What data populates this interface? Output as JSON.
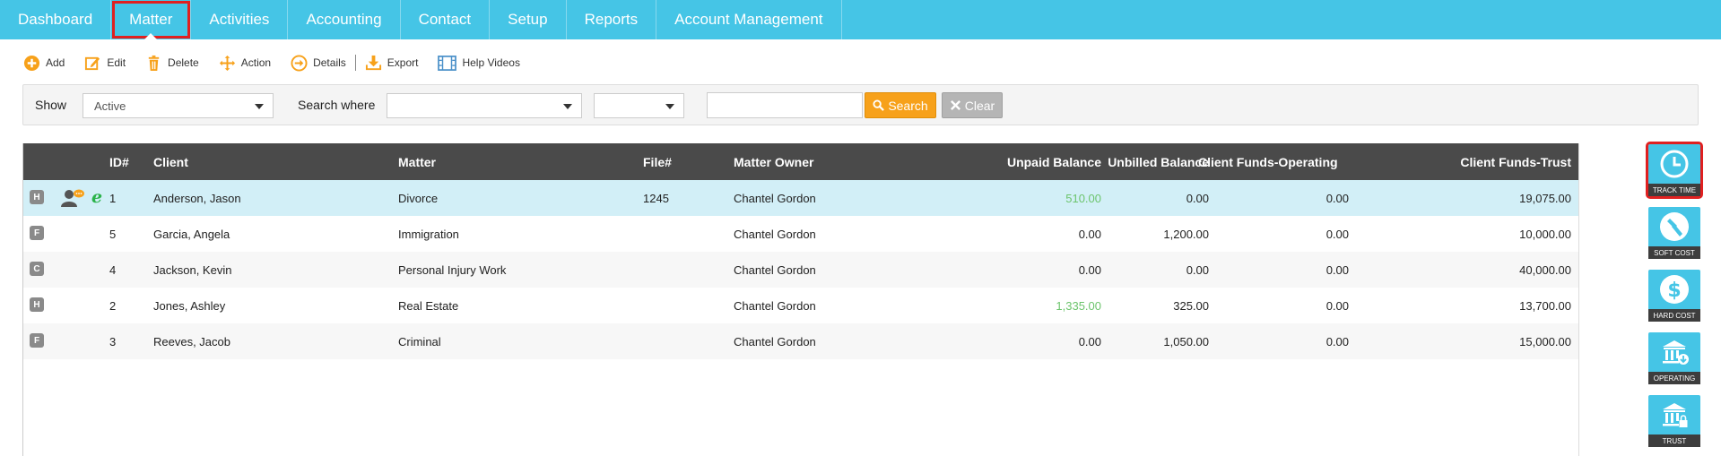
{
  "nav": {
    "items": [
      {
        "label": "Dashboard"
      },
      {
        "label": "Matter"
      },
      {
        "label": "Activities"
      },
      {
        "label": "Accounting"
      },
      {
        "label": "Contact"
      },
      {
        "label": "Setup"
      },
      {
        "label": "Reports"
      },
      {
        "label": "Account Management"
      }
    ],
    "active": "Matter"
  },
  "toolbar": {
    "add": "Add",
    "edit": "Edit",
    "delete": "Delete",
    "action": "Action",
    "details": "Details",
    "export": "Export",
    "help_videos": "Help Videos"
  },
  "filter": {
    "show_label": "Show",
    "show_value": "Active",
    "search_where_label": "Search where",
    "search_where_value": "",
    "operator_value": "",
    "search_text": "",
    "search_button": "Search",
    "clear_button": "Clear"
  },
  "table": {
    "headers": {
      "id": "ID#",
      "client": "Client",
      "matter": "Matter",
      "file": "File#",
      "owner": "Matter Owner",
      "unpaid": "Unpaid Balance",
      "unbilled": "Unbilled Balance",
      "operating": "Client Funds-Operating",
      "trust": "Client Funds-Trust"
    },
    "rows": [
      {
        "type": "H",
        "portal": true,
        "id": "1",
        "client": "Anderson, Jason",
        "matter": "Divorce",
        "file": "1245",
        "owner": "Chantel Gordon",
        "unpaid": "510.00",
        "unpaid_green": true,
        "unbilled": "0.00",
        "operating": "0.00",
        "trust": "19,075.00"
      },
      {
        "type": "F",
        "portal": false,
        "id": "5",
        "client": "Garcia, Angela",
        "matter": "Immigration",
        "file": "",
        "owner": "Chantel Gordon",
        "unpaid": "0.00",
        "unpaid_green": false,
        "unbilled": "1,200.00",
        "operating": "0.00",
        "trust": "10,000.00"
      },
      {
        "type": "C",
        "portal": false,
        "id": "4",
        "client": "Jackson, Kevin",
        "matter": "Personal Injury Work",
        "file": "",
        "owner": "Chantel Gordon",
        "unpaid": "0.00",
        "unpaid_green": false,
        "unbilled": "0.00",
        "operating": "0.00",
        "trust": "40,000.00"
      },
      {
        "type": "H",
        "portal": false,
        "id": "2",
        "client": "Jones, Ashley",
        "matter": "Real Estate",
        "file": "",
        "owner": "Chantel Gordon",
        "unpaid": "1,335.00",
        "unpaid_green": true,
        "unbilled": "325.00",
        "operating": "0.00",
        "trust": "13,700.00"
      },
      {
        "type": "F",
        "portal": false,
        "id": "3",
        "client": "Reeves, Jacob",
        "matter": "Criminal",
        "file": "",
        "owner": "Chantel Gordon",
        "unpaid": "0.00",
        "unpaid_green": false,
        "unbilled": "1,050.00",
        "operating": "0.00",
        "trust": "15,000.00"
      }
    ]
  },
  "quick_actions": [
    {
      "label": "TRACK TIME",
      "icon": "clock-icon",
      "highlighted": true
    },
    {
      "label": "SOFT COST",
      "icon": "gavel-icon",
      "highlighted": false
    },
    {
      "label": "HARD COST",
      "icon": "dollar-icon",
      "highlighted": false
    },
    {
      "label": "OPERATING",
      "icon": "bank-download-icon",
      "highlighted": false
    },
    {
      "label": "TRUST",
      "icon": "bank-lock-icon",
      "highlighted": false
    }
  ],
  "colors": {
    "brand": "#45c5e6",
    "header_dark": "#4a4a4a",
    "accent_orange": "#f7a11a",
    "highlight_red": "#e02020",
    "positive_green": "#6cc46c"
  }
}
